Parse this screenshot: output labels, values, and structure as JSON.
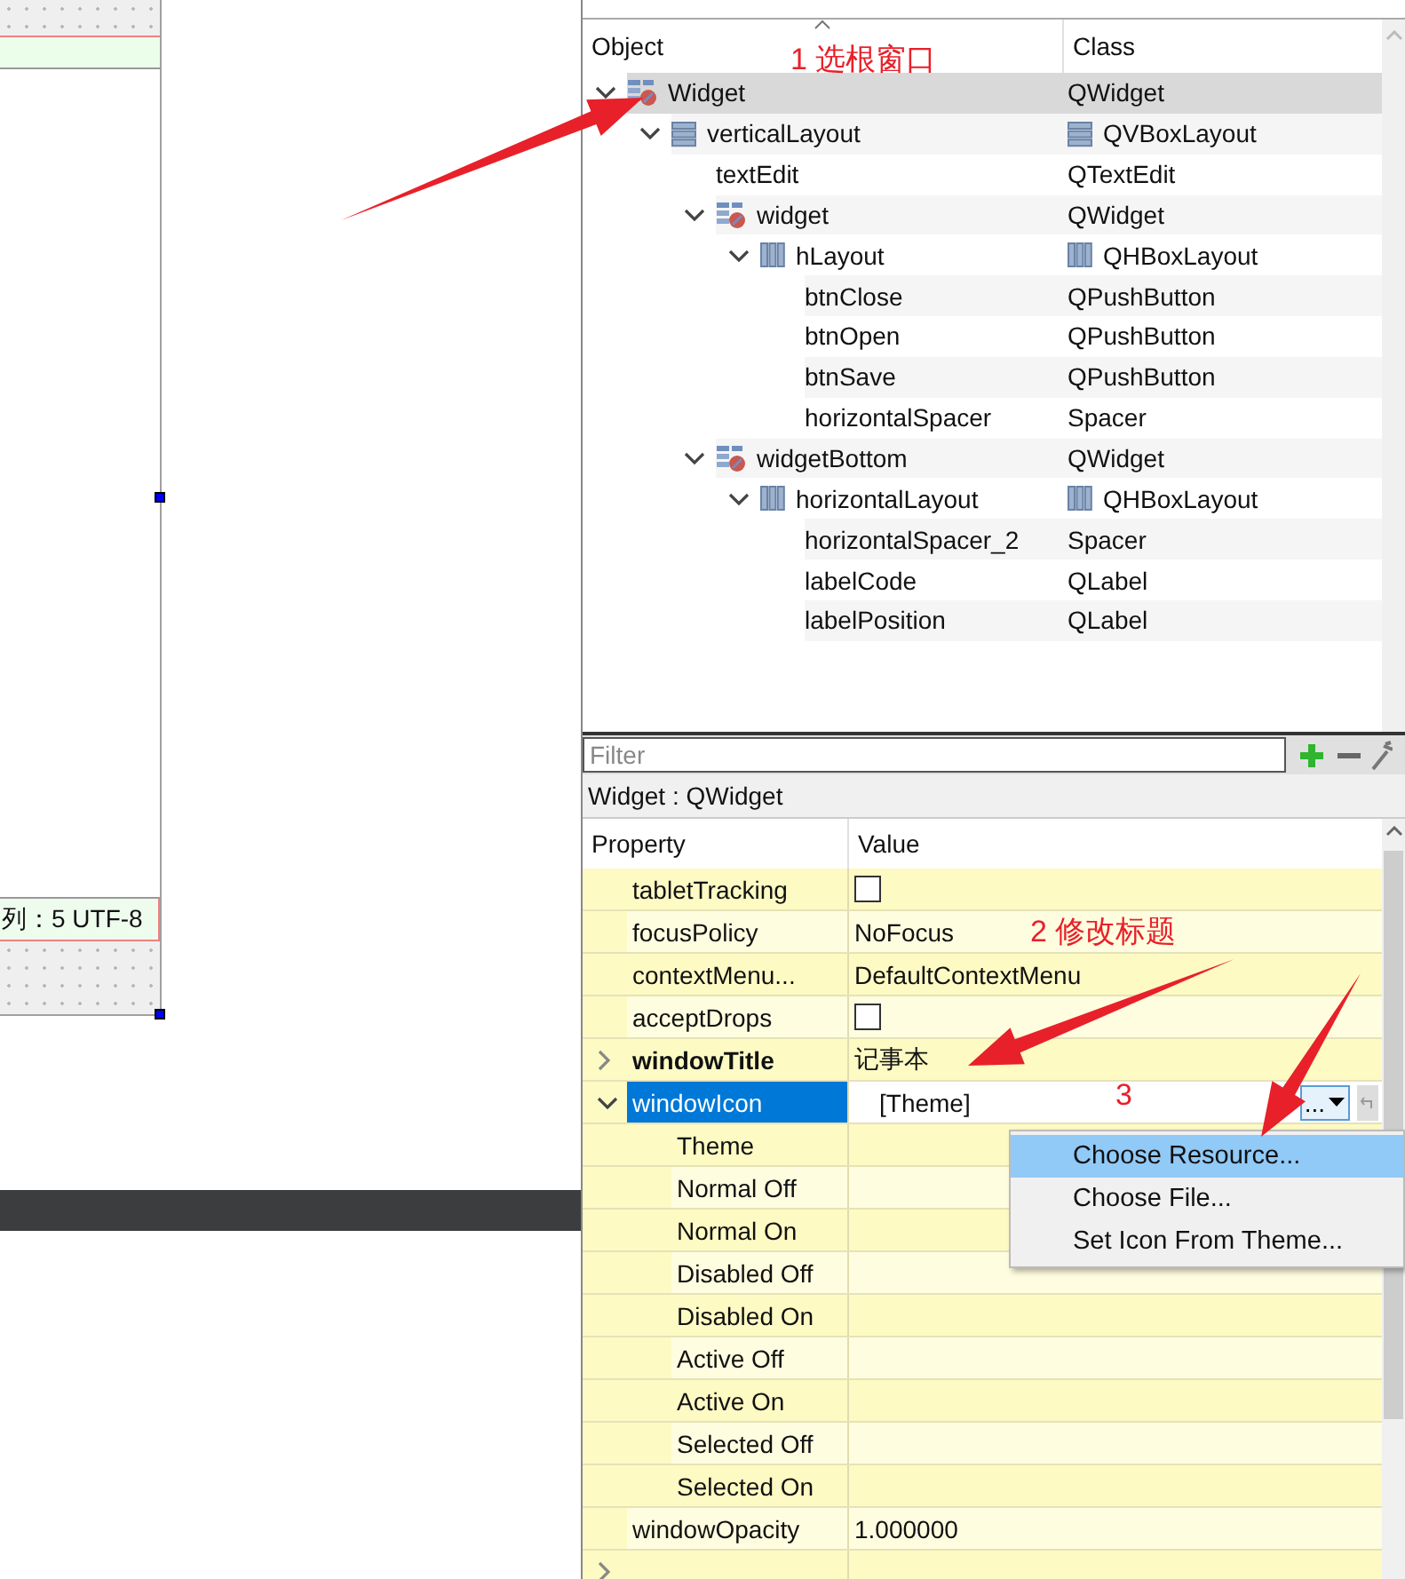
{
  "form_preview": {
    "status_text": "列：5 UTF-8"
  },
  "object_inspector": {
    "columns": [
      "Object",
      "Class"
    ],
    "tree": [
      {
        "name": "Widget",
        "class": "QWidget",
        "kind": "widget",
        "selected": true,
        "expanded": true,
        "children": [
          {
            "name": "verticalLayout",
            "class": "QVBoxLayout",
            "kind": "vlayout",
            "selected": false,
            "expanded": true,
            "children": [
              {
                "name": "textEdit",
                "class": "QTextEdit",
                "selected": false
              },
              {
                "name": "widget",
                "class": "QWidget",
                "kind": "widget",
                "selected": false,
                "expanded": true,
                "children": [
                  {
                    "name": "hLayout",
                    "class": "QHBoxLayout",
                    "kind": "hlayout",
                    "selected": false,
                    "expanded": true,
                    "children": [
                      {
                        "name": "btnClose",
                        "class": "QPushButton",
                        "selected": false
                      },
                      {
                        "name": "btnOpen",
                        "class": "QPushButton",
                        "selected": false
                      },
                      {
                        "name": "btnSave",
                        "class": "QPushButton",
                        "selected": false
                      },
                      {
                        "name": "horizontalSpacer",
                        "class": "Spacer",
                        "selected": false
                      }
                    ]
                  }
                ]
              },
              {
                "name": "widgetBottom",
                "class": "QWidget",
                "kind": "widget",
                "selected": false,
                "expanded": true,
                "children": [
                  {
                    "name": "horizontalLayout",
                    "class": "QHBoxLayout",
                    "kind": "hlayout",
                    "selected": false,
                    "expanded": true,
                    "children": [
                      {
                        "name": "horizontalSpacer_2",
                        "class": "Spacer",
                        "selected": false
                      },
                      {
                        "name": "labelCode",
                        "class": "QLabel",
                        "selected": false
                      },
                      {
                        "name": "labelPosition",
                        "class": "QLabel",
                        "selected": false
                      }
                    ]
                  }
                ]
              }
            ]
          }
        ]
      }
    ]
  },
  "property_editor": {
    "filter": {
      "placeholder": "Filter"
    },
    "object_title": "Widget : QWidget",
    "columns": [
      "Property",
      "Value"
    ],
    "rows": [
      {
        "name": "tabletTracking",
        "kind": "checkbox",
        "checked": false,
        "selected": false,
        "modified": false
      },
      {
        "name": "focusPolicy",
        "kind": "text",
        "value": "NoFocus",
        "selected": false,
        "modified": false
      },
      {
        "name": "contextMenu...",
        "kind": "text",
        "value": "DefaultContextMenu",
        "selected": false,
        "modified": false
      },
      {
        "name": "acceptDrops",
        "kind": "checkbox",
        "checked": false,
        "selected": false,
        "modified": false
      },
      {
        "name": "windowTitle",
        "kind": "text",
        "value": "记事本",
        "selected": false,
        "modified": true,
        "expanded": false
      },
      {
        "name": "windowIcon",
        "kind": "icon",
        "value": "[Theme]",
        "button": "...",
        "selected": true,
        "modified": false,
        "expanded": true,
        "children": [
          {
            "name": "Theme",
            "selected": false,
            "modified": false
          },
          {
            "name": "Normal Off",
            "selected": false,
            "modified": false
          },
          {
            "name": "Normal On",
            "selected": false,
            "modified": false
          },
          {
            "name": "Disabled Off",
            "selected": false,
            "modified": false
          },
          {
            "name": "Disabled On",
            "selected": false,
            "modified": false
          },
          {
            "name": "Active Off",
            "selected": false,
            "modified": false
          },
          {
            "name": "Active On",
            "selected": false,
            "modified": false
          },
          {
            "name": "Selected Off",
            "selected": false,
            "modified": false
          },
          {
            "name": "Selected On",
            "selected": false,
            "modified": false
          }
        ]
      },
      {
        "name": "windowOpacity",
        "kind": "text",
        "value": "1.000000",
        "selected": false,
        "modified": false
      },
      {
        "selected": false,
        "modified": false,
        "expanded": false
      }
    ]
  },
  "menu": {
    "items": [
      {
        "label": "Choose Resource...",
        "selected": true
      },
      {
        "label": "Choose File...",
        "selected": false
      },
      {
        "label": "Set Icon From Theme...",
        "selected": false
      }
    ]
  },
  "annotations": [
    {
      "text": "1 选根窗口"
    },
    {
      "text": "2 修改标题"
    },
    {
      "text": "3"
    }
  ]
}
